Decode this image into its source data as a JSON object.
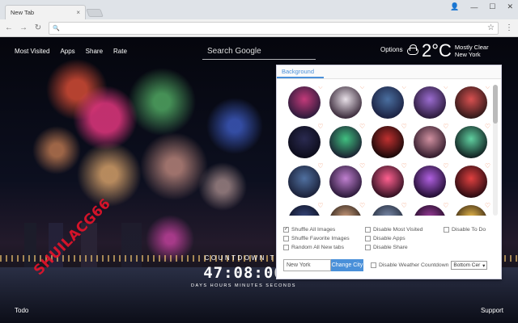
{
  "browser": {
    "tab_title": "New Tab",
    "tab_close": "×",
    "window_controls": [
      "👤",
      "—",
      "☐",
      "✕"
    ],
    "nav": {
      "back": "←",
      "forward": "→",
      "reload": "↻"
    },
    "omnibox_value": "",
    "omnibox_icon": "🔍",
    "star": "☆",
    "menu": "⋮"
  },
  "page": {
    "top_links": [
      "Most Visited",
      "Apps",
      "Share",
      "Rate"
    ],
    "search_placeholder": "Search Google",
    "options_label": "Options",
    "weather": {
      "temp": "2°C",
      "condition": "Mostly Clear",
      "city": "New York",
      "icon": "cloud-icon"
    },
    "countdown": {
      "label": "COUNTDOWN TO",
      "time": "47:08:06",
      "units": "DAYS  HOURS  MINUTES  SECONDS"
    },
    "todo": "Todo",
    "support": "Support",
    "watermark": "SHUILACG66"
  },
  "options_panel": {
    "tab_label": "Background",
    "thumbnails": [
      {
        "c1": "#c33a7a",
        "c2": "#2b1a3a"
      },
      {
        "c1": "#e8e0e8",
        "c2": "#3a2a3a"
      },
      {
        "c1": "#4a6fa0",
        "c2": "#1a2040"
      },
      {
        "c1": "#9b6cd0",
        "c2": "#2a1a3a"
      },
      {
        "c1": "#d85050",
        "c2": "#301818"
      },
      {
        "c1": "#2a2a50",
        "c2": "#0c0c1a"
      },
      {
        "c1": "#40c080",
        "c2": "#1a2030"
      },
      {
        "c1": "#c03030",
        "c2": "#180808"
      },
      {
        "c1": "#d090a0",
        "c2": "#301a2a"
      },
      {
        "c1": "#60d0a0",
        "c2": "#102020"
      },
      {
        "c1": "#5070a0",
        "c2": "#1a2038"
      },
      {
        "c1": "#c080d0",
        "c2": "#2a1838"
      },
      {
        "c1": "#ff6090",
        "c2": "#301020"
      },
      {
        "c1": "#b060e0",
        "c2": "#200c30"
      },
      {
        "c1": "#e04040",
        "c2": "#2a0a10"
      },
      {
        "c1": "#3a4a80",
        "c2": "#0c1020"
      },
      {
        "c1": "#d0a080",
        "c2": "#2a2018"
      },
      {
        "c1": "#8090b0",
        "c2": "#202838"
      },
      {
        "c1": "#a040a0",
        "c2": "#1a0820"
      },
      {
        "c1": "#f0c050",
        "c2": "#302010"
      }
    ],
    "heart": "♡",
    "checkboxes": [
      {
        "label": "Shuffle All Images",
        "checked": true
      },
      {
        "label": "Disable Most Visited",
        "checked": false
      },
      {
        "label": "Disable To Do",
        "checked": false
      },
      {
        "label": "Shuffle Favorite Images",
        "checked": false
      },
      {
        "label": "Disable Apps",
        "checked": false
      },
      {
        "label": "",
        "checked": false
      },
      {
        "label": "Random All New tabs",
        "checked": false
      },
      {
        "label": "Disable Share",
        "checked": false
      },
      {
        "label": "",
        "checked": false
      }
    ],
    "location_value": "New York",
    "change_city": "Change City",
    "weather_countdown_label": "Disable Weather Countdown",
    "position_select": "Bottom Cer",
    "select_arrow": "▾"
  }
}
